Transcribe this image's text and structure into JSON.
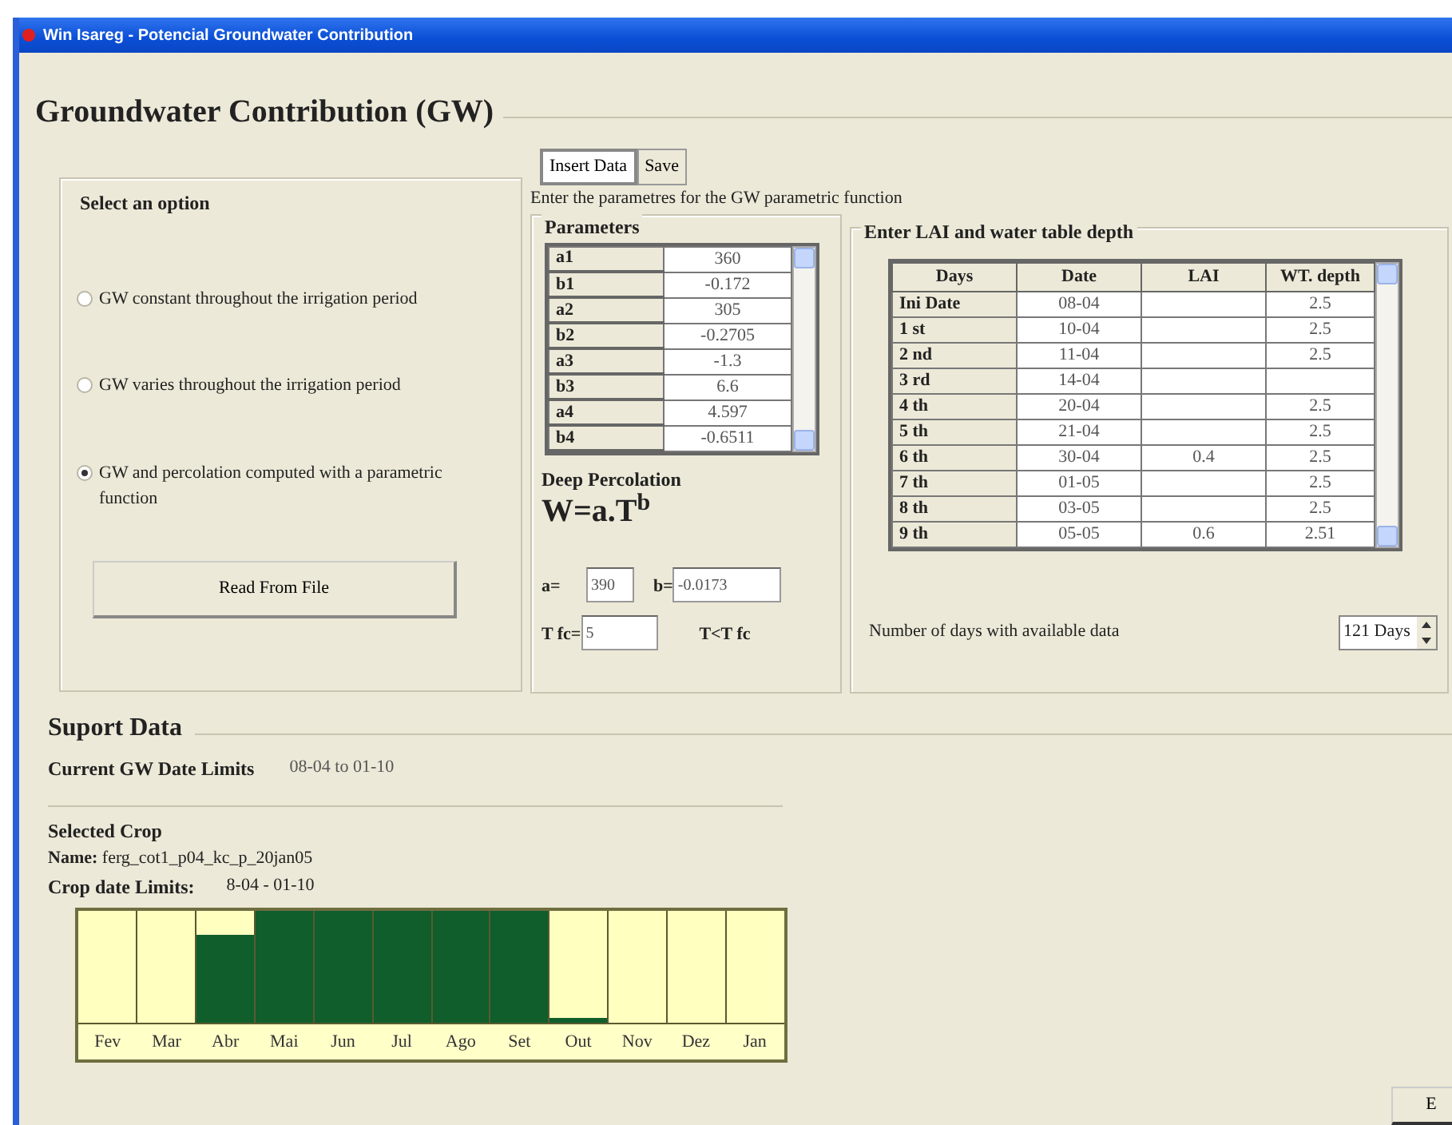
{
  "window": {
    "title": "Win Isareg - Potencial Groundwater Contribution"
  },
  "heading": "Groundwater Contribution (GW)",
  "options": {
    "title": "Select an option",
    "items": [
      {
        "label": "GW constant throughout the irrigation period",
        "selected": false
      },
      {
        "label": "GW varies throughout the irrigation period",
        "selected": false
      },
      {
        "label": "GW and percolation computed with a parametric function",
        "selected": true
      }
    ],
    "button": "Read From File"
  },
  "tabs": [
    {
      "label": "Insert Data",
      "selected": true
    },
    {
      "label": "Save",
      "selected": false
    }
  ],
  "instructions": "Enter the parametres for the GW parametric function",
  "parameters": {
    "title": "Parameters",
    "rows": [
      {
        "name": "a1",
        "value": "360"
      },
      {
        "name": "b1",
        "value": "-0.172"
      },
      {
        "name": "a2",
        "value": "305"
      },
      {
        "name": "b2",
        "value": "-0.2705"
      },
      {
        "name": "a3",
        "value": "-1.3"
      },
      {
        "name": "b3",
        "value": "6.6"
      },
      {
        "name": "a4",
        "value": "4.597"
      },
      {
        "name": "b4",
        "value": "-0.6511"
      }
    ]
  },
  "deep_percolation": {
    "title": "Deep Percolation",
    "formula": "W=a.T$^{b}$",
    "a_label": "a=",
    "a_value": "390",
    "b_label": "b=",
    "b_value": "-0.0173",
    "tfc_label": "T fc=",
    "tfc_value": "5",
    "condition": "T<T fc"
  },
  "lai": {
    "title": "Enter LAI and water table depth",
    "columns": [
      "Days",
      "Date",
      "LAI",
      "WT. depth"
    ],
    "rows": [
      {
        "days": "Ini Date",
        "date": "08-04",
        "wt_depth": "2.5"
      },
      {
        "days": "1 st",
        "date": "10-04",
        "wt_depth": "2.5"
      },
      {
        "days": "2 nd",
        "date": "11-04",
        "wt_depth": "2.5"
      },
      {
        "days": "3 rd",
        "date": "14-04"
      },
      {
        "days": "4 th",
        "date": "20-04",
        "wt_depth": "2.5"
      },
      {
        "days": "5 th",
        "date": "21-04",
        "wt_depth": "2.5"
      },
      {
        "days": "6 th",
        "date": "30-04",
        "lai": "0.4",
        "wt_depth": "2.5"
      },
      {
        "days": "7 th",
        "date": "01-05",
        "wt_depth": "2.5"
      },
      {
        "days": "8 th",
        "date": "03-05",
        "wt_depth": "2.5"
      },
      {
        "days": "9 th",
        "date": "05-05",
        "lai": "0.6",
        "wt_depth": "2.51"
      }
    ]
  },
  "days_available": {
    "label": "Number of days with available data",
    "value": "121 Days"
  },
  "support": {
    "title": "Suport Data",
    "gw_limits_label": "Current GW Date Limits",
    "gw_limits": "08-04 to 01-10",
    "crop_title": "Selected Crop",
    "crop_name": "**Name:** ferg_cot1_p04_kc_p_20jan05",
    "crop_limits_label": "Crop date Limits:",
    "crop_limits": "8-04 - 01-10",
    "months": [
      {
        "label": "Fev",
        "level": 0
      },
      {
        "label": "Mar",
        "level": 0
      },
      {
        "label": "Abr",
        "level": 0.78
      },
      {
        "label": "Mai",
        "level": 1
      },
      {
        "label": "Jun",
        "level": 1
      },
      {
        "label": "Jul",
        "level": 1
      },
      {
        "label": "Ago",
        "level": 1
      },
      {
        "label": "Set",
        "level": 1
      },
      {
        "label": "Out",
        "level": 0.03
      },
      {
        "label": "Nov",
        "level": 0
      },
      {
        "label": "Dez",
        "level": 0
      },
      {
        "label": "Jan",
        "level": 0
      }
    ]
  },
  "buttons": [
    "E"
  ]
}
